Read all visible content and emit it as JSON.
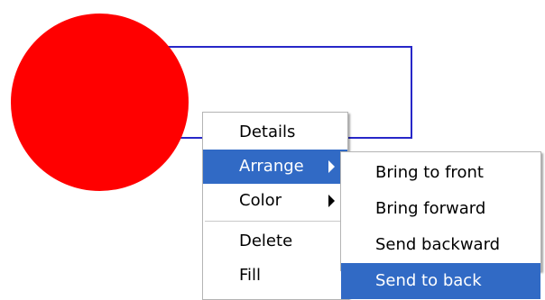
{
  "canvas": {
    "rectangle": {
      "fill": "#ffffff",
      "stroke": "#2727c8"
    },
    "circle": {
      "fill": "#ff0000"
    }
  },
  "context_menu": {
    "items": [
      {
        "label": "Details",
        "has_submenu": false,
        "highlighted": false
      },
      {
        "label": "Arrange",
        "has_submenu": true,
        "highlighted": true
      },
      {
        "label": "Color",
        "has_submenu": true,
        "highlighted": false
      },
      {
        "label": "Delete",
        "has_submenu": false,
        "highlighted": false
      },
      {
        "label": "Fill",
        "has_submenu": false,
        "highlighted": false
      }
    ]
  },
  "arrange_submenu": {
    "items": [
      {
        "label": "Bring to front",
        "highlighted": false
      },
      {
        "label": "Bring forward",
        "highlighted": false
      },
      {
        "label": "Send backward",
        "highlighted": false
      },
      {
        "label": "Send to back",
        "highlighted": true
      }
    ]
  },
  "colors": {
    "highlight": "#316ac5",
    "highlight_text": "#ffffff",
    "text": "#000000"
  }
}
